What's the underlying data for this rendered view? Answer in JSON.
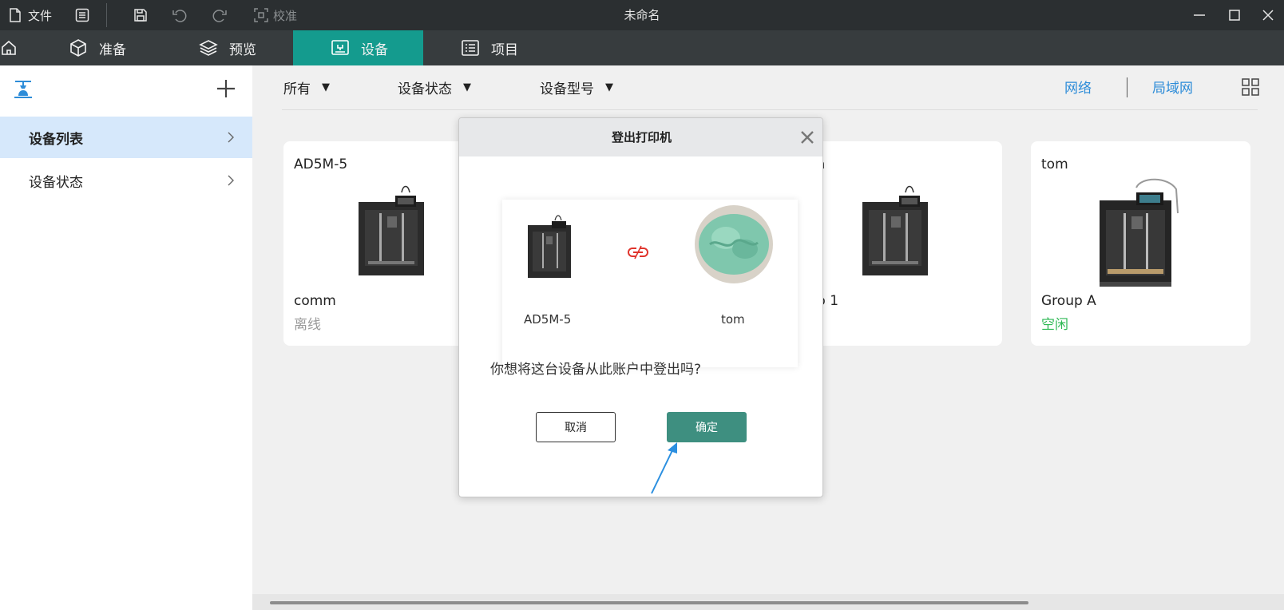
{
  "titlebar": {
    "file_label": "文件",
    "calibrate_label": "校准",
    "window_title": "未命名"
  },
  "tabs": [
    {
      "label": "准备"
    },
    {
      "label": "预览"
    },
    {
      "label": "设备",
      "active": true
    },
    {
      "label": "项目"
    }
  ],
  "sidebar": {
    "items": [
      {
        "label": "设备列表",
        "active": true
      },
      {
        "label": "设备状态"
      }
    ]
  },
  "filters": {
    "all": "所有",
    "status": "设备状态",
    "model": "设备型号"
  },
  "network": {
    "network_label": "网络",
    "lan_label": "局域网"
  },
  "cards": [
    {
      "name": "AD5M-5",
      "group": "comm",
      "status": "离线",
      "status_color": "#9a9a9a"
    },
    {
      "name": "a",
      "group": "p 1",
      "status": ""
    },
    {
      "name": "tom",
      "group": "Group A",
      "status": "空闲",
      "status_color": "#2fb955"
    }
  ],
  "dialog": {
    "title": "登出打印机",
    "device_name": "AD5M-5",
    "account_name": "tom",
    "question": "你想将这台设备从此账户中登出吗?",
    "cancel_label": "取消",
    "confirm_label": "确定"
  },
  "colors": {
    "accent_tab": "#149b8e",
    "link": "#2d8cd8",
    "confirm_button": "#3e8f80",
    "unlink_icon": "#e0342c"
  }
}
